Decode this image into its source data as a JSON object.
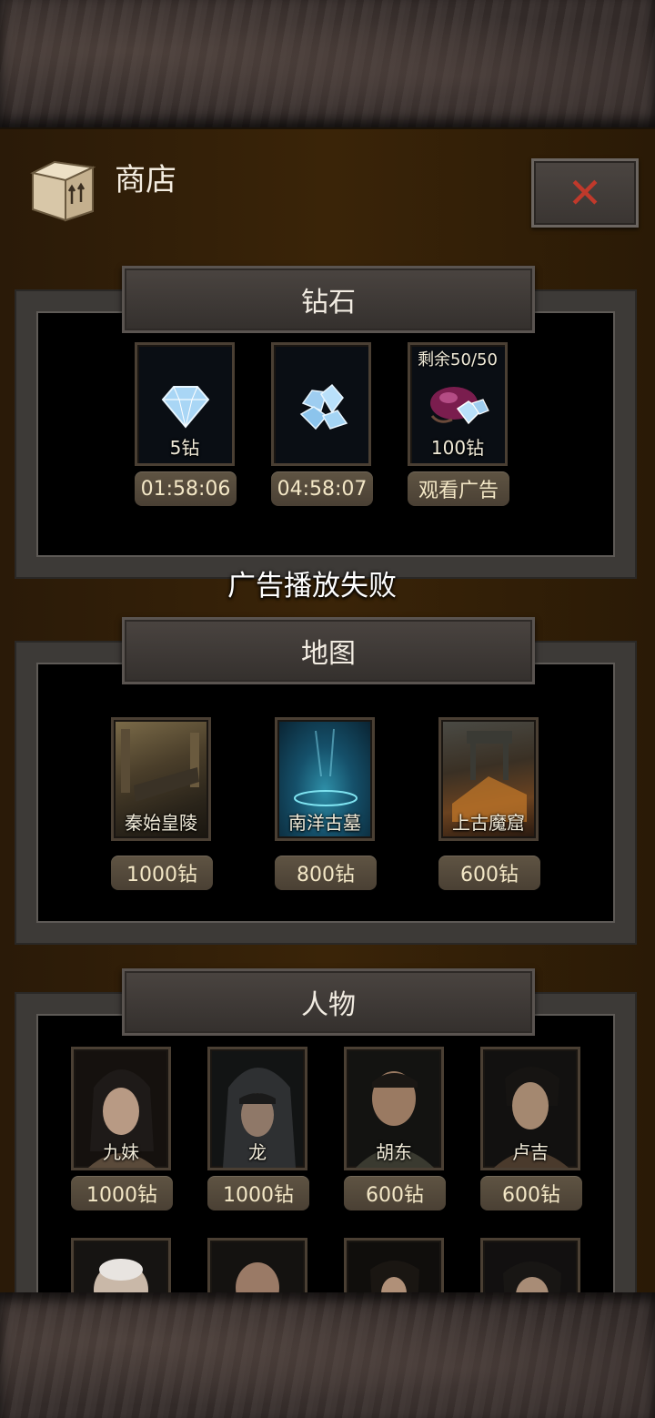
{
  "shop": {
    "title": "商店",
    "toast": "广告播放失败"
  },
  "sections": {
    "diamond": {
      "title": "钻石",
      "items": [
        {
          "caption": "5钻",
          "action": "01:58:06",
          "icon": "diamond-icon"
        },
        {
          "caption": "",
          "action": "04:58:07",
          "icon": "diamond-pile-icon"
        },
        {
          "caption": "100钻",
          "top": "剩余50/50",
          "action": "观看广告",
          "icon": "diamond-bag-icon"
        }
      ]
    },
    "map": {
      "title": "地图",
      "items": [
        {
          "name": "秦始皇陵",
          "price": "1000钻"
        },
        {
          "name": "南洋古墓",
          "price": "800钻"
        },
        {
          "name": "上古魔窟",
          "price": "600钻"
        }
      ]
    },
    "character": {
      "title": "人物",
      "items": [
        {
          "name": "九妹",
          "price": "1000钻"
        },
        {
          "name": "龙",
          "price": "1000钻"
        },
        {
          "name": "胡东",
          "price": "600钻"
        },
        {
          "name": "卢吉",
          "price": "600钻"
        }
      ]
    }
  },
  "colors": {
    "close_x": "#c0392b",
    "panel_bg": "#3a2408",
    "frame": "#3d3a37",
    "pill": "#5f5443"
  }
}
